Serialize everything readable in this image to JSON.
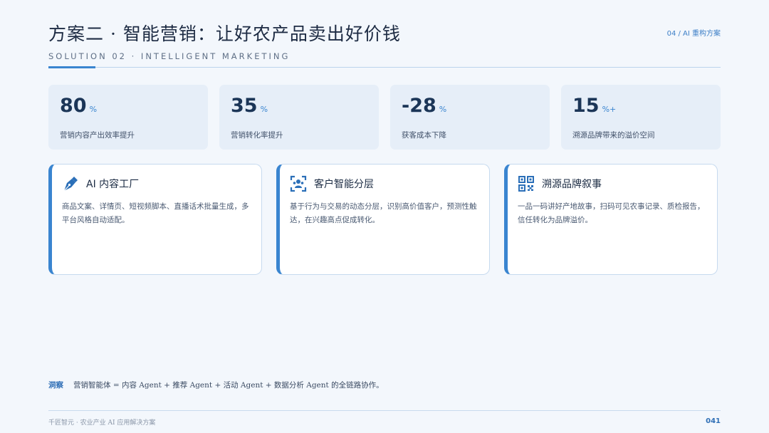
{
  "header": {
    "title": "方案二 · 智能营销：让好农产品卖出好价钱",
    "subtitle": "SOLUTION 02 · INTELLIGENT MARKETING",
    "section_tag": "04 / AI 重构方案"
  },
  "stats": [
    {
      "value": "80",
      "unit": "%",
      "label": "营销内容产出效率提升"
    },
    {
      "value": "35",
      "unit": "%",
      "label": "营销转化率提升"
    },
    {
      "value": "-28",
      "unit": "%",
      "label": "获客成本下降"
    },
    {
      "value": "15",
      "unit": "%+",
      "label": "溯源品牌带来的溢价空间"
    }
  ],
  "cards": [
    {
      "icon": "pen-nib-icon",
      "title": "AI 内容工厂",
      "body": "商品文案、详情页、短视频脚本、直播话术批量生成，多平台风格自动适配。"
    },
    {
      "icon": "user-focus-icon",
      "title": "客户智能分层",
      "body": "基于行为与交易的动态分层，识别高价值客户，预测性触达，在兴趣高点促成转化。"
    },
    {
      "icon": "qr-code-icon",
      "title": "溯源品牌叙事",
      "body": "一品一码讲好产地故事，扫码可见农事记录、质检报告，信任转化为品牌溢价。"
    }
  ],
  "insight": {
    "label": "洞察",
    "text": "营销智能体 = 内容 Agent + 推荐 Agent + 活动 Agent + 数据分析 Agent 的全链路协作。"
  },
  "footer": {
    "left": "千匠智元 · 农业产业 AI 应用解决方案",
    "page": "041"
  },
  "colors": {
    "accent": "#3a85d0",
    "stat_bg": "#e6eef8",
    "page_bg": "#f3f7fc",
    "title": "#1d2b43"
  }
}
